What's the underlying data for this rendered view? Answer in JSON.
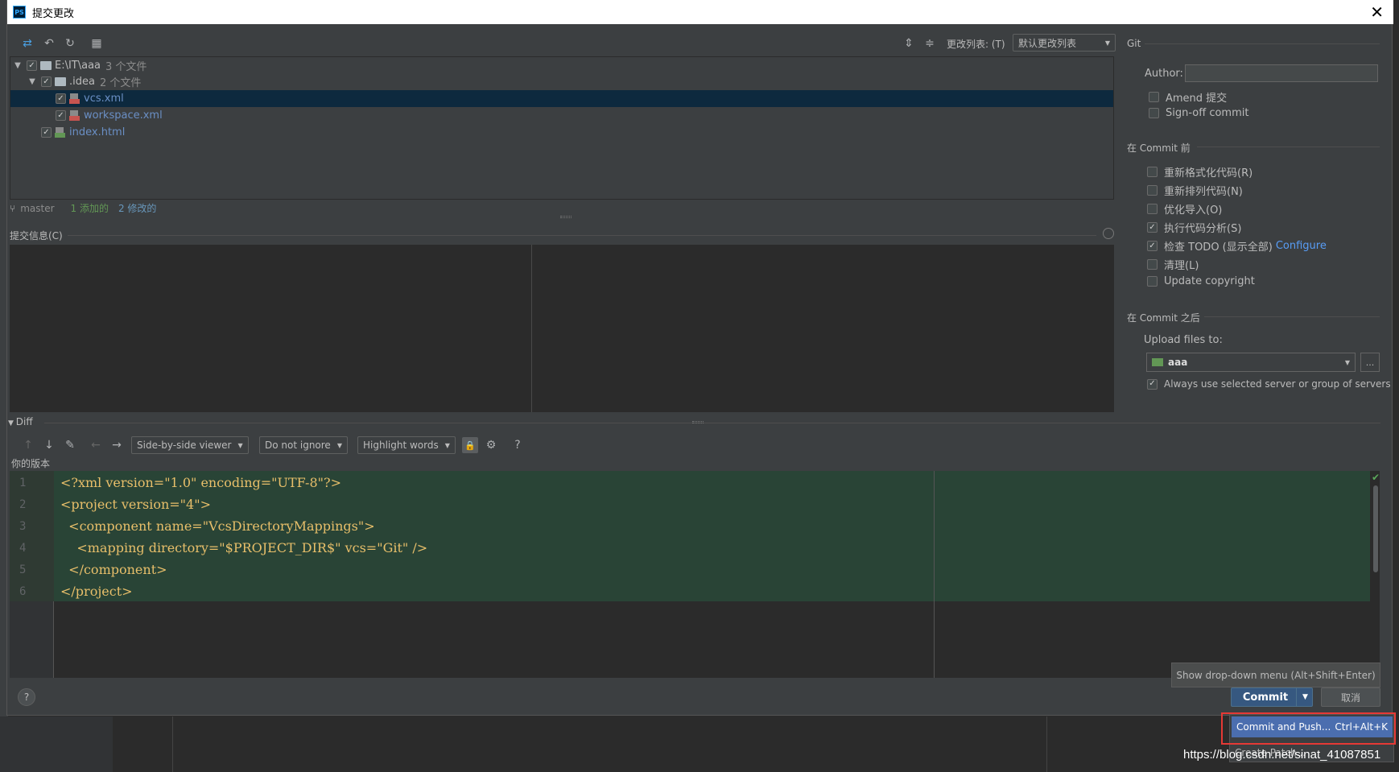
{
  "window": {
    "title": "提交更改",
    "app_icon": "PS"
  },
  "toolbar": {
    "icons": [
      "move-icon",
      "undo-icon",
      "refresh-icon",
      "group-icon",
      "expand-all-icon",
      "collapse-all-icon"
    ],
    "changelist_label": "更改列表: (T)",
    "changelist_value": "默认更改列表"
  },
  "tree": {
    "root": {
      "path": "E:\\IT\\aaa",
      "count": "3 个文件"
    },
    "folder": {
      "name": ".idea",
      "count": "2 个文件"
    },
    "files": [
      {
        "name": "vcs.xml",
        "status": "modified"
      },
      {
        "name": "workspace.xml",
        "status": "modified"
      },
      {
        "name": "index.html",
        "status": "modified"
      }
    ]
  },
  "status": {
    "branch": "master",
    "added": "1 添加的",
    "modified": "2 修改的"
  },
  "commit_message": {
    "label": "提交信息(C)",
    "value": ""
  },
  "diff": {
    "label": "Diff",
    "viewer": "Side-by-side viewer",
    "ignore": "Do not ignore",
    "highlight": "Highlight words",
    "help": "?",
    "your_version": "你的版本",
    "lines": [
      {
        "num": "1",
        "text": "<?xml version=\"1.0\" encoding=\"UTF-8\"?>"
      },
      {
        "num": "2",
        "text": "<project version=\"4\">"
      },
      {
        "num": "3",
        "text": "  <component name=\"VcsDirectoryMappings\">"
      },
      {
        "num": "4",
        "text": "    <mapping directory=\"$PROJECT_DIR$\" vcs=\"Git\" />"
      },
      {
        "num": "5",
        "text": "  </component>"
      },
      {
        "num": "6",
        "text": "</project>"
      }
    ]
  },
  "git_panel": {
    "title": "Git",
    "author_label": "Author:",
    "author_value": "",
    "amend": "Amend 提交",
    "signoff": "Sign-off commit",
    "before_title": "在 Commit 前",
    "before_options": [
      {
        "label": "重新格式化代码(R)",
        "checked": false
      },
      {
        "label": "重新排列代码(N)",
        "checked": false
      },
      {
        "label": "优化导入(O)",
        "checked": false
      },
      {
        "label": "执行代码分析(S)",
        "checked": true
      },
      {
        "label": "检查 TODO (显示全部)",
        "checked": true
      },
      {
        "label": "清理(L)",
        "checked": false
      },
      {
        "label": "Update copyright",
        "checked": false
      }
    ],
    "configure_link": "Configure",
    "after_title": "在 Commit 之后",
    "upload_label": "Upload files to:",
    "upload_value": "aaa",
    "upload_more": "...",
    "always_use": "Always use selected server or group of servers"
  },
  "footer": {
    "tooltip": "Show drop-down menu (Alt+Shift+Enter)",
    "commit": "Commit",
    "cancel": "取消",
    "popup_item": "Commit and Push...",
    "popup_shortcut": "Ctrl+Alt+K",
    "popup_item2": "Create Patch..."
  },
  "watermark": "https://blog.csdn.net/sinat_41087851",
  "colors": {
    "accent": "#365880",
    "selection": "#0d293e",
    "added_bg": "#294436",
    "highlight_box": "#e53935"
  }
}
